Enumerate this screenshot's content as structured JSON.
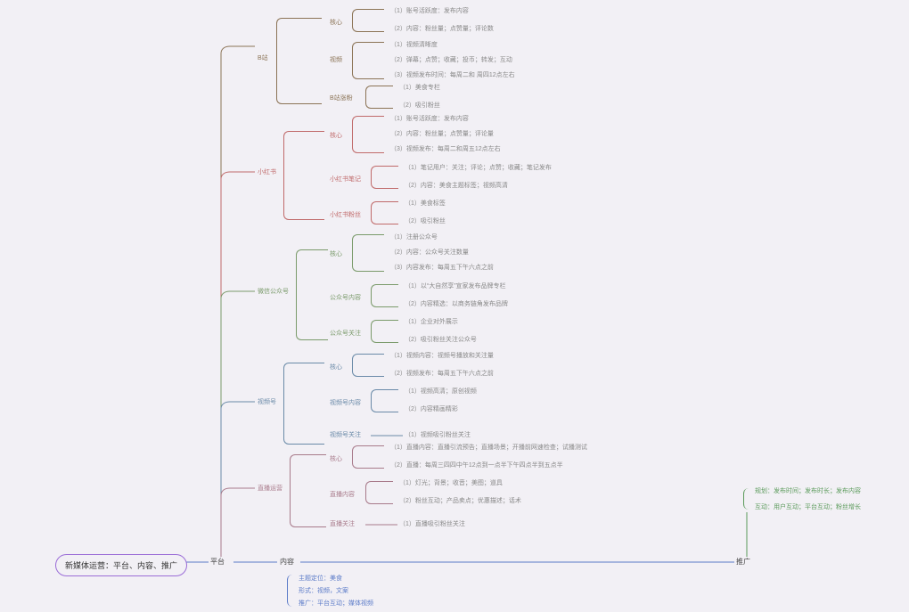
{
  "root": "新媒体运营：平台、内容、推广",
  "platform": "平台",
  "content": "内容",
  "promotion": "推广",
  "bili": {
    "title": "B站",
    "core": "核心",
    "core_items": [
      "（1）账号活跃度：发布内容",
      "（2）内容：粉丝量；点赞量；评论数"
    ],
    "video": "视频",
    "video_items": [
      "（1）视频清晰度",
      "（2）弹幕；点赞；收藏；投币；转发；互动",
      "（3）视频发布时间：每周二和 周四12点左右"
    ],
    "growth": "B站涨粉",
    "growth_items": [
      "（1）美食专栏",
      "（2）吸引粉丝"
    ]
  },
  "xhs": {
    "title": "小红书",
    "core": "核心",
    "core_items": [
      "（1）账号活跃度：发布内容",
      "（2）内容：粉丝量；点赞量；评论量",
      "（3）视频发布：每周二和周五12点左右"
    ],
    "note": "小红书笔记",
    "note_items": [
      "（1）笔记用户：关注；评论；点赞；收藏；笔记发布",
      "（2）内容：美食主题标签；视频高清"
    ],
    "fans": "小红书粉丝",
    "fans_items": [
      "（1）美食标签",
      "（2）吸引粉丝"
    ]
  },
  "wx": {
    "title": "微信公众号",
    "core": "核心",
    "core_items": [
      "（1）注册公众号",
      "（2）内容：公众号关注数量",
      "（3）内容发布：每周五下午六点之前"
    ],
    "content": "公众号内容",
    "content_items": [
      "（1）以“大自然享”宣家发布品牌专栏",
      "（2）内容精选：以商务链角发布品牌"
    ],
    "follow": "公众号关注",
    "follow_items": [
      "（1）企业对外展示",
      "（2）吸引粉丝关注公众号"
    ]
  },
  "sph": {
    "title": "视频号",
    "core": "核心",
    "core_items": [
      "（1）视频内容：视频号播放和关注量",
      "（2）视频发布：每周五下午六点之前"
    ],
    "content": "视频号内容",
    "content_items": [
      "（1）视频高清；原创视频",
      "（2）内容精画精彩"
    ],
    "follow": "视频号关注",
    "follow_items": [
      "（1）视频吸引粉丝关注"
    ]
  },
  "live": {
    "title": "直播运营",
    "core": "核心",
    "core_items": [
      "（1）直播内容：直播引流预告；直播场景；开播前网速检查；试播测试",
      "（2）直播：每周三四四中午12点到一点半下午四点半到五点半"
    ],
    "content": "直播内容",
    "content_items": [
      "（1）灯光；背景；收音；美图；道具",
      "（2）粉丝互动；产品卖点；优惠描述；话术"
    ],
    "follow": "直播关注",
    "follow_items": [
      "（1）直播吸引粉丝关注"
    ]
  },
  "content_sub": {
    "pos": "主题定位：美食",
    "form": "形式：视频，文案",
    "promo": "推广：平台互动；媒体视频"
  },
  "promo_sub": {
    "plan": "规划：发布时间；发布时长；发布内容",
    "inter": "互动：用户互动；平台互动；粉丝增长"
  }
}
